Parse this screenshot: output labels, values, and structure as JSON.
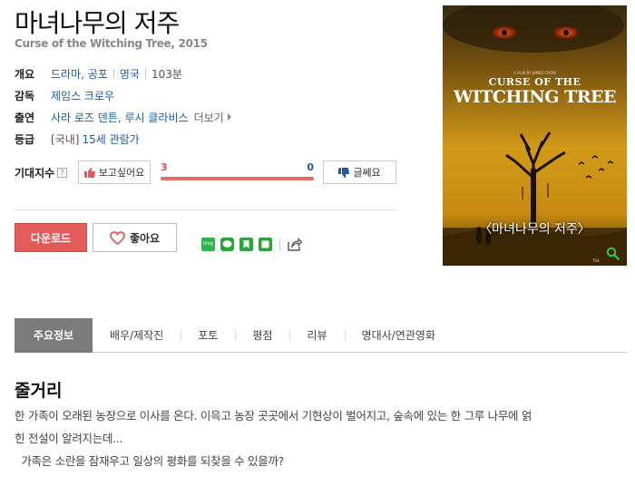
{
  "movie": {
    "title": "마녀나무의 저주",
    "original_title": "Curse of the Witching Tree, 2015"
  },
  "info": {
    "overview_label": "개요",
    "genre": "드라마, 공포",
    "country": "영국",
    "runtime": "103분",
    "director_label": "감독",
    "director": "제임스 크로우",
    "cast_label": "출연",
    "cast": "사라 로즈 덴튼, 루시 클라비스",
    "more_label": "더보기",
    "rating_label": "등급",
    "rating_prefix": "[국내]",
    "rating": "15세 관람가"
  },
  "expectation": {
    "label": "기대지수",
    "help": "?",
    "want_label": "보고싶어요",
    "want_count": "3",
    "doubt_label": "글쎄요",
    "doubt_count": "0",
    "want_ratio": 1.0
  },
  "actions": {
    "download_label": "다운로드",
    "like_label": "좋아요"
  },
  "poster": {
    "credit_line": "A FILM BY JAMES CROW",
    "title_line1": "CURSE OF THE",
    "title_line2": "WITCHING TREE",
    "kr_title": "〈마녀나무의 저주〉",
    "watermark": "TSA"
  },
  "tabs": [
    "주요정보",
    "배우/제작진",
    "포토",
    "평점",
    "리뷰",
    "명대사/연관영화"
  ],
  "synopsis": {
    "heading": "줄거리",
    "line1": "한 가족이 오래된 농장으로 이사를 온다. 이윽고 농장 곳곳에서 기현상이 벌어지고, 숲속에 있는 한 그루 나무에 얽",
    "line2": "힌 전설이 알려지는데...",
    "line3": "  가족은 소란을 잠재우고 일상의 평화를 되찾을 수 있을까?"
  },
  "colors": {
    "accent_red": "#e35a5a",
    "link_blue": "#1c5ca7",
    "tab_active": "#7a7a7a"
  }
}
